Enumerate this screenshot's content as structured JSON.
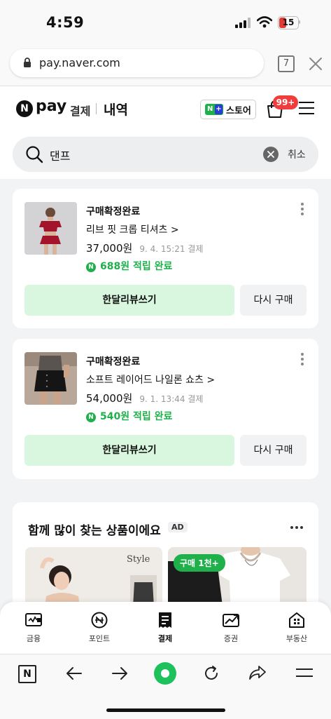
{
  "status_bar": {
    "time": "4:59",
    "battery": "15"
  },
  "browser": {
    "url": "pay.naver.com",
    "tab_count": "7"
  },
  "header": {
    "logo_pay": "pay",
    "tab_payment": "결제",
    "tab_history": "내역",
    "store_label": "스토어",
    "cart_badge": "99+"
  },
  "search": {
    "query": "댄프",
    "cancel_label": "취소"
  },
  "orders": [
    {
      "status": "구매확정완료",
      "product": "리브 핏 크롭 티셔츠 >",
      "price": "37,000원",
      "date": "9. 4. 15:21 결제",
      "points": "688원 적립 완료",
      "review_label": "한달리뷰쓰기",
      "rebuy_label": "다시 구매"
    },
    {
      "status": "구매확정완료",
      "product": "소프트 레이어드 나일론 쇼츠 >",
      "price": "54,000원",
      "date": "9. 1. 13:44 결제",
      "points": "540원 적립 완료",
      "review_label": "한달리뷰쓰기",
      "rebuy_label": "다시 구매"
    }
  ],
  "recommend": {
    "title": "함께 많이 찾는 상품이에요",
    "ad_badge": "AD",
    "style_label": "Style",
    "purchase_badge": "구매 1천+"
  },
  "bottom_nav": [
    {
      "label": "금융",
      "icon": "wallet-icon"
    },
    {
      "label": "포인트",
      "icon": "point-coin-icon"
    },
    {
      "label": "결제",
      "icon": "receipt-icon"
    },
    {
      "label": "증권",
      "icon": "stock-chart-icon"
    },
    {
      "label": "부동산",
      "icon": "building-icon"
    }
  ],
  "colors": {
    "accent_green": "#1fb04b",
    "button_green_bg": "#d9f7df",
    "badge_red": "#f03c3c"
  }
}
